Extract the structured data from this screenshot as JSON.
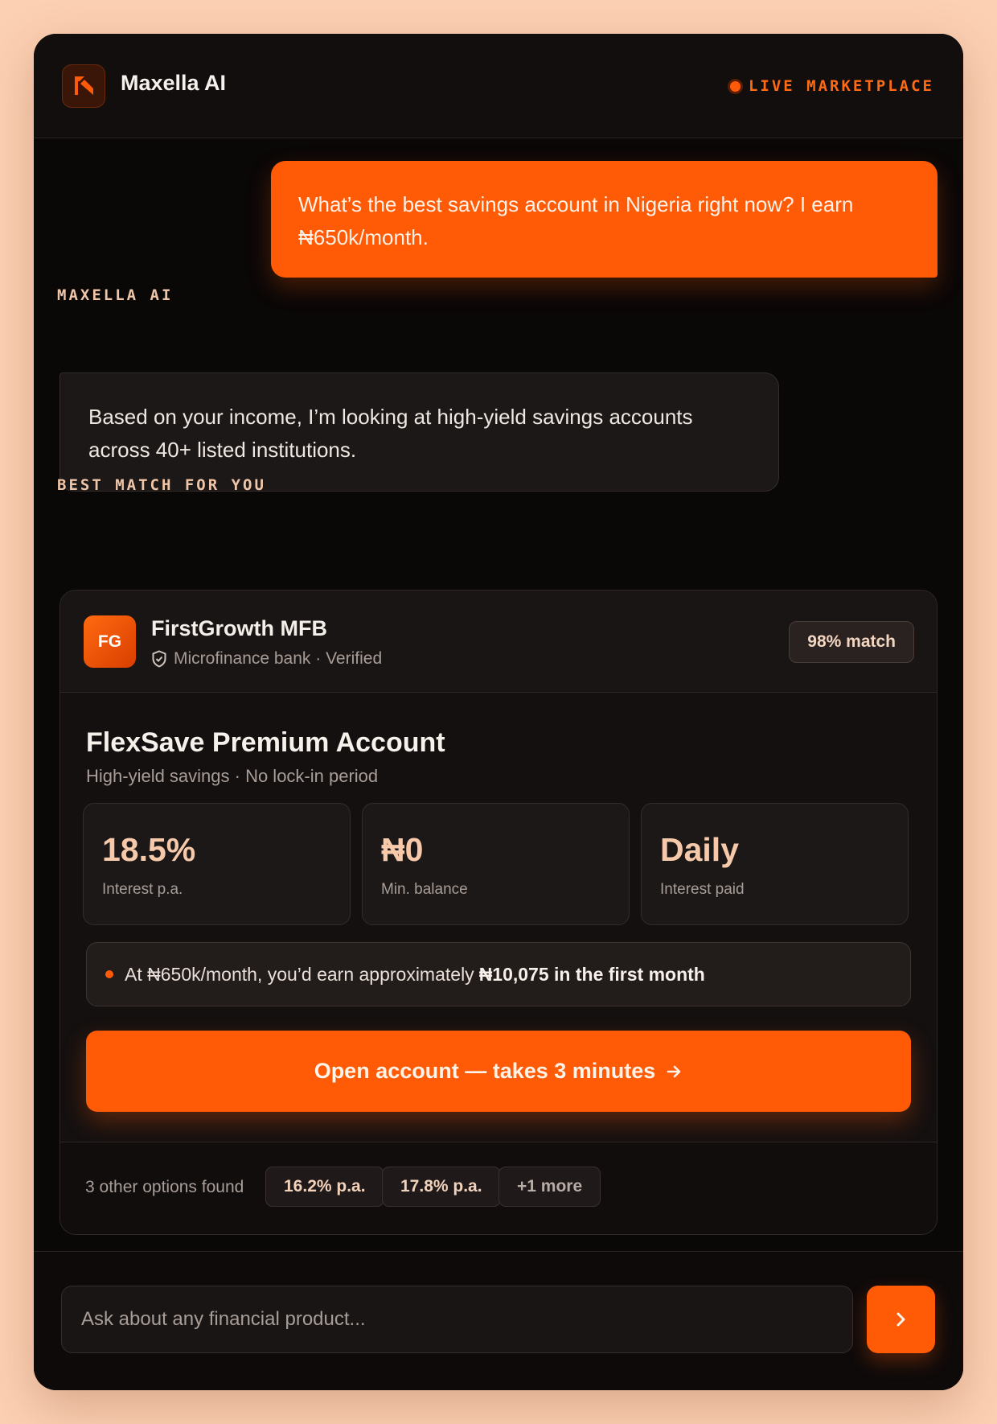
{
  "app": {
    "title": "Maxella AI",
    "status_label": "LIVE MARKETPLACE"
  },
  "conversation": {
    "user_message": "What’s the best savings account in Nigeria right now? I earn ₦650k/month.",
    "assistant_label": "MAXELLA AI",
    "assistant_message": "Based on your income, I’m looking at high-yield savings accounts across 40+ listed institutions."
  },
  "best_match": {
    "section_label": "BEST MATCH FOR YOU",
    "institution": {
      "initials": "FG",
      "name": "FirstGrowth MFB",
      "subtitle": "Microfinance bank · Verified",
      "verified_icon": "shield-check-icon"
    },
    "match_badge": "98% match",
    "product": {
      "title": "FlexSave Premium Account",
      "subtitle": "High-yield savings · No lock-in period"
    },
    "stats": [
      {
        "value": "18.5%",
        "label": "Interest p.a."
      },
      {
        "value": "₦0",
        "label": "Min. balance"
      },
      {
        "value": "Daily",
        "label": "Interest paid"
      }
    ],
    "earnings": {
      "prefix": "At ₦650k/month, you’d earn approximately",
      "highlight": "₦10,075 in the first month"
    },
    "cta_label": "Open account — takes 3 minutes",
    "cta_icon": "arrow-right-icon",
    "other_options": {
      "label": "3 other options found",
      "chips": [
        "16.2% p.a.",
        "17.8% p.a.",
        "+1 more"
      ]
    }
  },
  "composer": {
    "placeholder": "Ask about any financial product...",
    "value": "",
    "send_icon": "chevron-right-icon"
  },
  "colors": {
    "accent": "#ff5a05",
    "background": "#0a0707",
    "page_background": "#fcd0b3"
  }
}
